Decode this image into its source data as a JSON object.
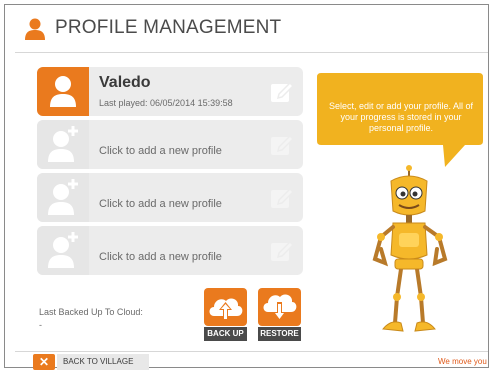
{
  "header": {
    "title": "PROFILE MANAGEMENT",
    "icon": "person-icon"
  },
  "profiles": [
    {
      "name": "Valedo",
      "last_played": "Last played: 06/05/2014 15:39:58"
    },
    {
      "add_label": "Click to add a new profile"
    },
    {
      "add_label": "Click to add a new profile"
    },
    {
      "add_label": "Click to add a new profile"
    }
  ],
  "backup": {
    "label": "Last Backed Up To Cloud:",
    "value": "-"
  },
  "buttons": {
    "backup": "BACK UP",
    "restore": "RESTORE"
  },
  "bubble": {
    "text": "Select, edit or add your profile. All of your progress is stored in your personal profile."
  },
  "footer": {
    "back_label": "BACK TO VILLAGE",
    "tagline": "We move you"
  },
  "colors": {
    "accent": "#ea7a1e",
    "bubble": "#f1b21f"
  }
}
